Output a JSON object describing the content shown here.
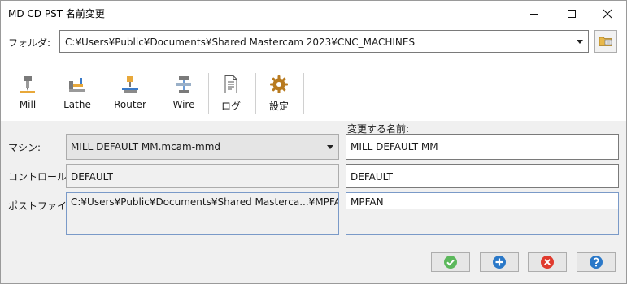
{
  "window": {
    "title": "MD CD PST 名前変更",
    "minimize_icon": "minimize-icon",
    "maximize_icon": "maximize-icon",
    "close_icon": "close-icon"
  },
  "folder": {
    "label": "フォルダ:",
    "value": "C:¥Users¥Public¥Documents¥Shared Mastercam 2023¥CNC_MACHINES",
    "browse_icon": "folder-browse-icon"
  },
  "toolbar": {
    "items": [
      {
        "label": "Mill",
        "icon": "mill-icon"
      },
      {
        "label": "Lathe",
        "icon": "lathe-icon"
      },
      {
        "label": "Router",
        "icon": "router-icon"
      },
      {
        "label": "Wire",
        "icon": "wire-icon"
      },
      {
        "label": "ログ",
        "icon": "log-document-icon"
      },
      {
        "label": "設定",
        "icon": "gear-icon"
      }
    ]
  },
  "form": {
    "rename_header": "変更する名前:",
    "machine": {
      "label": "マシン:",
      "value": "MILL DEFAULT MM.mcam-mmd",
      "new_name": "MILL DEFAULT MM"
    },
    "control": {
      "label": "コントロール:",
      "value": "DEFAULT",
      "new_name": "DEFAULT"
    },
    "post": {
      "label": "ポストファイル:",
      "value": "C:¥Users¥Public¥Documents¥Shared Masterca...¥MPFAN.PST",
      "new_name": "MPFAN"
    }
  },
  "buttons": [
    {
      "icon": "check-icon",
      "color": "#5cb85c"
    },
    {
      "icon": "plus-icon",
      "color": "#2a78c8"
    },
    {
      "icon": "cancel-icon",
      "color": "#e03a2e"
    },
    {
      "icon": "help-icon",
      "color": "#2a78c8"
    }
  ]
}
